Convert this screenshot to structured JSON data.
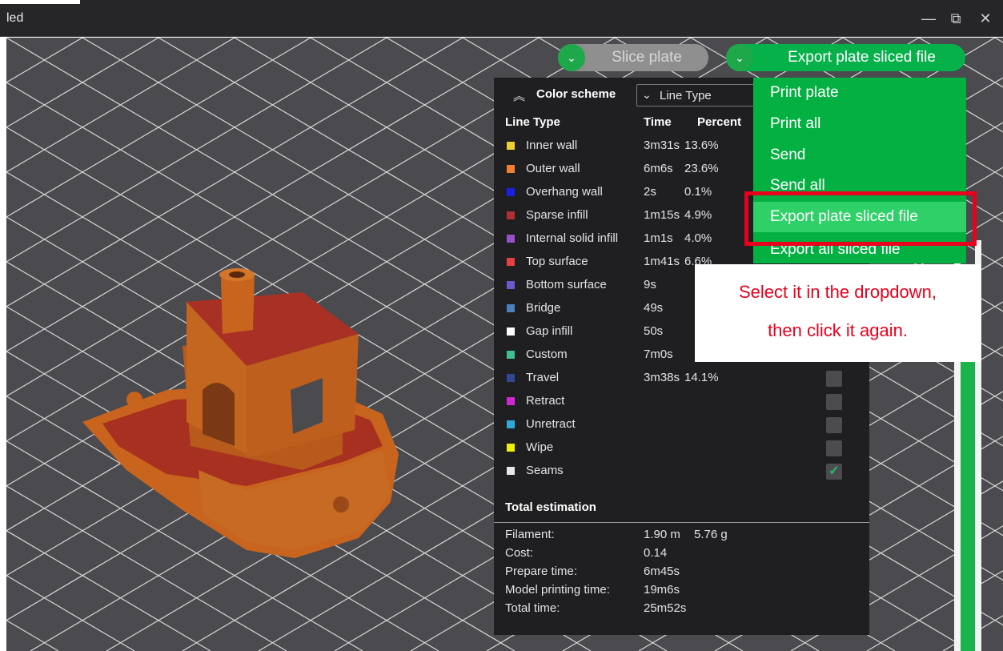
{
  "window": {
    "title": "led",
    "controls": [
      "—",
      "⧉",
      "✕"
    ]
  },
  "toolbar": {
    "dropdown_arrow": "⌄",
    "slice_label": "Slice plate",
    "export_label": "Export plate sliced file"
  },
  "dropdown": {
    "items": [
      {
        "label": "Print plate"
      },
      {
        "label": "Print all"
      },
      {
        "label": "Send"
      },
      {
        "label": "Send all"
      },
      {
        "label": "Export plate sliced file",
        "highlighted": true
      },
      {
        "label": "Export all sliced file"
      }
    ]
  },
  "color_scheme": {
    "collapse_icon": "︽",
    "title": "Color scheme",
    "combo_caret": "⌄",
    "combo_value": "Line Type",
    "headers": {
      "type": "Line Type",
      "time": "Time",
      "percent": "Percent"
    },
    "rows": [
      {
        "name": "Inner wall",
        "time": "3m31s",
        "percent": "13.6%",
        "color": "#f0d030"
      },
      {
        "name": "Outer wall",
        "time": "6m6s",
        "percent": "23.6%",
        "color": "#f08030"
      },
      {
        "name": "Overhang wall",
        "time": "2s",
        "percent": "0.1%",
        "color": "#1a20e8"
      },
      {
        "name": "Sparse infill",
        "time": "1m15s",
        "percent": "4.9%",
        "color": "#b03030"
      },
      {
        "name": "Internal solid infill",
        "time": "1m1s",
        "percent": "4.0%",
        "color": "#9850c8"
      },
      {
        "name": "Top surface",
        "time": "1m41s",
        "percent": "6.6%",
        "color": "#e84040"
      },
      {
        "name": "Bottom surface",
        "time": "9s",
        "percent": "",
        "color": "#6a5ad0"
      },
      {
        "name": "Bridge",
        "time": "49s",
        "percent": "",
        "color": "#4a80c0"
      },
      {
        "name": "Gap infill",
        "time": "50s",
        "percent": "",
        "color": "#ffffff"
      },
      {
        "name": "Custom",
        "time": "7m0s",
        "percent": "",
        "color": "#40c090"
      },
      {
        "name": "Travel",
        "time": "3m38s",
        "percent": "14.1%",
        "color": "#304890"
      },
      {
        "name": "Retract",
        "time": "",
        "percent": "",
        "color": "#d028d0"
      },
      {
        "name": "Unretract",
        "time": "",
        "percent": "",
        "color": "#30a8d8"
      },
      {
        "name": "Wipe",
        "time": "",
        "percent": "",
        "color": "#f0f000"
      },
      {
        "name": "Seams",
        "time": "",
        "percent": "",
        "color": "#e8e8e8"
      }
    ],
    "checkbox_mark": "✓",
    "total_title": "Total estimation",
    "estimation": [
      {
        "label": "Filament:",
        "value": "1.90 m",
        "extra": "5.76 g"
      },
      {
        "label": "Cost:",
        "value": "0.14"
      },
      {
        "label": "Prepare time:",
        "value": "6m45s"
      },
      {
        "label": "Model printing time:",
        "value": "19m6s"
      },
      {
        "label": "Total time:",
        "value": "25m52s"
      }
    ]
  },
  "annotation": {
    "line1": "Select it in the dropdown,",
    "line2": "then click it again."
  },
  "colors": {
    "accent_green": "#06b14a",
    "highlight_green": "#2ed067",
    "annotation_red": "#e8001c",
    "model_orange": "#c8641e"
  }
}
